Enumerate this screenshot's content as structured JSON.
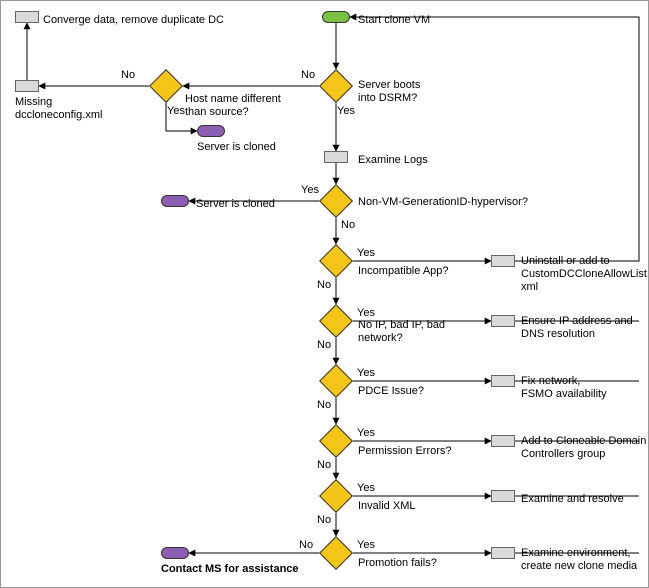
{
  "terminators": {
    "start": "Start clone VM",
    "cloned1": "Server is cloned",
    "cloned2": "Server is cloned",
    "contact": "Contact MS for assistance"
  },
  "processes": {
    "converge": "Converge data, remove duplicate DC",
    "missing": "Missing\ndccloneconfig.xml",
    "examine": "Examine Logs",
    "uninstall": "Uninstall or add to\nCustomDCCloneAllowList.\nxml",
    "ensureIP": "Ensure IP address and\nDNS resolution",
    "fixNet": "Fix network,\nFSMO availability",
    "addGroup": "Add to Cloneable Domain\nControllers group",
    "examRes": "Examine and resolve",
    "examEnv": "Examine environment,\ncreate new clone media"
  },
  "decisions": {
    "host": "Host name different\nthan source?",
    "dsrm": "Server boots\ninto DSRM?",
    "nonvm": "Non-VM-GenerationID-hypervisor?",
    "incomp": "Incompatible App?",
    "noip": "No IP, bad IP, bad\nnetwork?",
    "pdce": "PDCE Issue?",
    "perm": "Permission Errors?",
    "xml": "Invalid XML",
    "promo": "Promotion fails?"
  },
  "edges": {
    "yes": "Yes",
    "no": "No"
  },
  "chart_data": {
    "type": "flowchart",
    "title": "DC clone troubleshooting flow",
    "nodes": [
      {
        "id": "start",
        "type": "terminator",
        "label": "Start clone VM"
      },
      {
        "id": "converge",
        "type": "process",
        "label": "Converge data, remove duplicate DC"
      },
      {
        "id": "missing",
        "type": "process",
        "label": "Missing dccloneconfig.xml"
      },
      {
        "id": "host",
        "type": "decision",
        "label": "Host name different than source?"
      },
      {
        "id": "cloned1",
        "type": "terminator",
        "label": "Server is cloned"
      },
      {
        "id": "dsrm",
        "type": "decision",
        "label": "Server boots into DSRM?"
      },
      {
        "id": "examine",
        "type": "process",
        "label": "Examine Logs"
      },
      {
        "id": "nonvm",
        "type": "decision",
        "label": "Non-VM-GenerationID-hypervisor?"
      },
      {
        "id": "cloned2",
        "type": "terminator",
        "label": "Server is cloned"
      },
      {
        "id": "incomp",
        "type": "decision",
        "label": "Incompatible App?"
      },
      {
        "id": "uninstall",
        "type": "process",
        "label": "Uninstall or add to CustomDCCloneAllowList.xml"
      },
      {
        "id": "noip",
        "type": "decision",
        "label": "No IP, bad IP, bad network?"
      },
      {
        "id": "ensureIP",
        "type": "process",
        "label": "Ensure IP address and DNS resolution"
      },
      {
        "id": "pdce",
        "type": "decision",
        "label": "PDCE Issue?"
      },
      {
        "id": "fixNet",
        "type": "process",
        "label": "Fix network, FSMO availability"
      },
      {
        "id": "perm",
        "type": "decision",
        "label": "Permission Errors?"
      },
      {
        "id": "addGroup",
        "type": "process",
        "label": "Add to Cloneable Domain Controllers group"
      },
      {
        "id": "xml",
        "type": "decision",
        "label": "Invalid XML"
      },
      {
        "id": "examRes",
        "type": "process",
        "label": "Examine and resolve"
      },
      {
        "id": "promo",
        "type": "decision",
        "label": "Promotion fails?"
      },
      {
        "id": "examEnv",
        "type": "process",
        "label": "Examine environment, create new clone media"
      },
      {
        "id": "contact",
        "type": "terminator",
        "label": "Contact MS for assistance"
      }
    ],
    "edges": [
      {
        "from": "start",
        "to": "dsrm"
      },
      {
        "from": "dsrm",
        "label": "No",
        "to": "host"
      },
      {
        "from": "dsrm",
        "label": "Yes",
        "to": "examine"
      },
      {
        "from": "host",
        "label": "No",
        "to": "missing"
      },
      {
        "from": "host",
        "label": "Yes",
        "to": "cloned1"
      },
      {
        "from": "missing",
        "to": "converge"
      },
      {
        "from": "examine",
        "to": "nonvm"
      },
      {
        "from": "nonvm",
        "label": "Yes",
        "to": "cloned2"
      },
      {
        "from": "nonvm",
        "label": "No",
        "to": "incomp"
      },
      {
        "from": "incomp",
        "label": "Yes",
        "to": "uninstall"
      },
      {
        "from": "incomp",
        "label": "No",
        "to": "noip"
      },
      {
        "from": "uninstall",
        "to": "start"
      },
      {
        "from": "noip",
        "label": "Yes",
        "to": "ensureIP"
      },
      {
        "from": "noip",
        "label": "No",
        "to": "pdce"
      },
      {
        "from": "ensureIP",
        "to": "start"
      },
      {
        "from": "pdce",
        "label": "Yes",
        "to": "fixNet"
      },
      {
        "from": "pdce",
        "label": "No",
        "to": "perm"
      },
      {
        "from": "fixNet",
        "to": "start"
      },
      {
        "from": "perm",
        "label": "Yes",
        "to": "addGroup"
      },
      {
        "from": "perm",
        "label": "No",
        "to": "xml"
      },
      {
        "from": "addGroup",
        "to": "start"
      },
      {
        "from": "xml",
        "label": "Yes",
        "to": "examRes"
      },
      {
        "from": "xml",
        "label": "No",
        "to": "promo"
      },
      {
        "from": "examRes",
        "to": "start"
      },
      {
        "from": "promo",
        "label": "Yes",
        "to": "examEnv"
      },
      {
        "from": "promo",
        "label": "No",
        "to": "contact"
      },
      {
        "from": "examEnv",
        "to": "start"
      }
    ]
  }
}
